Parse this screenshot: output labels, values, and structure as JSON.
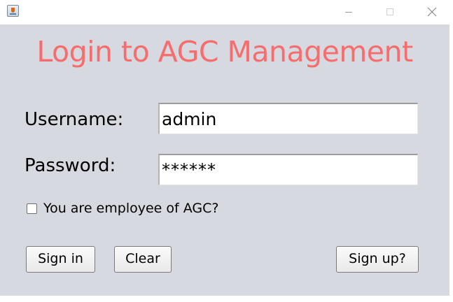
{
  "window": {
    "title": "",
    "icon": "java-cup-icon",
    "controls": {
      "minimize": "minimize-icon",
      "maximize": "maximize-icon",
      "close": "close-icon"
    }
  },
  "form": {
    "heading": "Login to AGC Management",
    "heading_color": "#f76c6c",
    "background_color": "#d7d9e0",
    "username": {
      "label": "Username:",
      "value": "admin"
    },
    "password": {
      "label": "Password:",
      "value": "******"
    },
    "employee_checkbox": {
      "label": "You are employee of AGC?",
      "checked": false
    },
    "buttons": {
      "sign_in": "Sign in",
      "clear": "Clear",
      "sign_up": "Sign up?"
    }
  }
}
